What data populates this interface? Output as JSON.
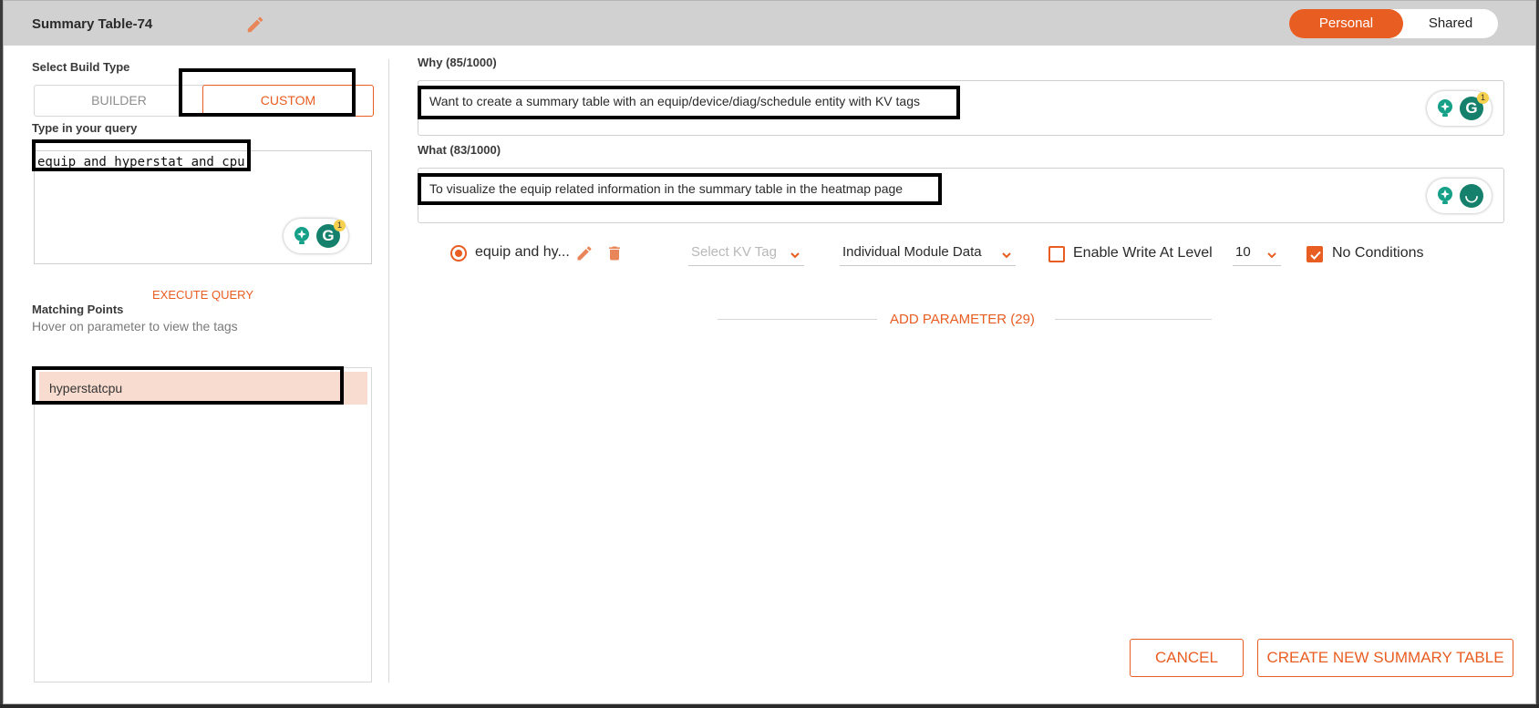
{
  "header": {
    "title": "Summary Table-74",
    "toggle": {
      "personal": "Personal",
      "shared": "Shared",
      "selected": "Personal"
    }
  },
  "left": {
    "build_type_label": "Select Build Type",
    "builder_label": "BUILDER",
    "custom_label": "CUSTOM",
    "selected_build": "CUSTOM",
    "query_label": "Type in your query",
    "query_value": "equip and hyperstat and cpu",
    "grammarly_badge": "1",
    "execute_label": "EXECUTE QUERY",
    "matching_label": "Matching Points",
    "matching_hint": "Hover on parameter to view the tags",
    "points": [
      "hyperstatcpu"
    ]
  },
  "right": {
    "why_label": "Why (85/1000)",
    "why_value": "Want to create a summary table with an equip/device/diag/schedule entity with KV tags",
    "why_badge": "1",
    "what_label": "What (83/1000)",
    "what_value": "To visualize the equip related information in the summary table in the heatmap page",
    "param_row": {
      "name": "equip and hy...",
      "kv_tag_placeholder": "Select KV Tag",
      "data_type": "Individual Module Data",
      "enable_write_label": "Enable Write At Level",
      "enable_write_checked": false,
      "level": "10",
      "no_conditions_label": "No Conditions",
      "no_conditions_checked": true
    },
    "add_parameter_label": "ADD PARAMETER (29)"
  },
  "footer": {
    "cancel_label": "CANCEL",
    "create_label": "CREATE NEW SUMMARY TABLE"
  },
  "colors": {
    "accent": "#e85d22",
    "header_bg": "#d1d1d1",
    "highlight_point": "#f9dcd0",
    "grammarly_green": "#15806b"
  }
}
